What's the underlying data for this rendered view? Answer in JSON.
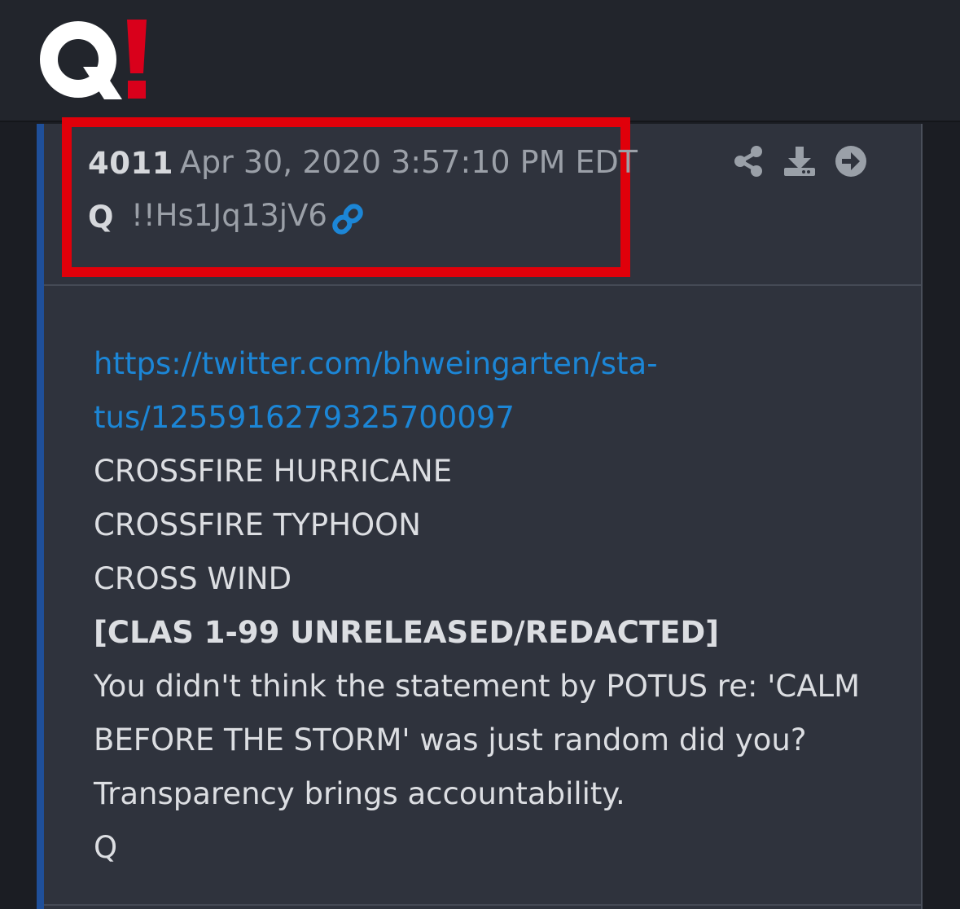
{
  "header": {
    "logo_letter": "Q",
    "logo_mark": "!",
    "logo_color": "#ffffff",
    "logo_accent_color": "#d9001b"
  },
  "post": {
    "number": "4011",
    "date": "Apr 30, 2020 3:57:10 PM EDT",
    "author": "Q",
    "tripcode": "!!Hs1Jq13jV6",
    "highlight_color": "#e0000a",
    "actions": [
      {
        "icon": "share-icon",
        "label": "share"
      },
      {
        "icon": "download-icon",
        "label": "download"
      },
      {
        "icon": "arrow-circle-right-icon",
        "label": "next"
      }
    ],
    "body": {
      "link_line_1": "https://twitter.com/bhweingarten/sta-",
      "link_line_2": "tus/1255916279325700097",
      "line_1": "CROSSFIRE HURRICANE",
      "line_2": "CROSSFIRE TYPHOON",
      "line_3": "CROSS WIND",
      "line_4": "[CLAS 1-99 UNRELEASED/REDACTED]",
      "line_5": "You didn't think the statement by POTUS re: 'CALM",
      "line_6": "BEFORE THE STORM' was just random did you?",
      "line_7": "Transparency brings accountability.",
      "line_8": "Q"
    },
    "link_color": "#1c86d6"
  }
}
